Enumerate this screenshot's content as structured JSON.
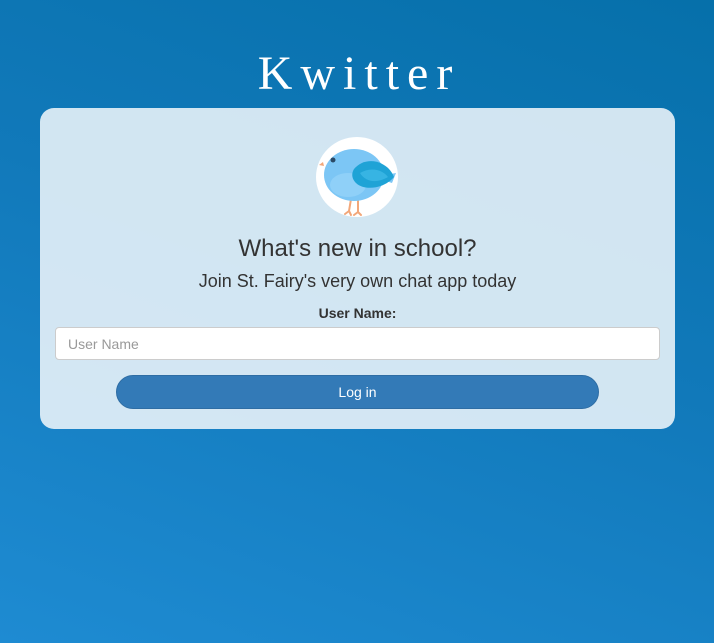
{
  "app": {
    "title": "Kwitter"
  },
  "login_card": {
    "logo_icon": "bird-icon",
    "headline": "What's new in school?",
    "subline": "Join St. Fairy's very own chat app today",
    "username_label": "User Name:",
    "username_value": "",
    "username_placeholder": "User Name",
    "login_button_label": "Log in"
  },
  "colors": {
    "background_top": "#0670aa",
    "background_bottom": "#1e8bd2",
    "card_background": "#e8f2f8",
    "button_primary": "#337ab7",
    "bird_body": "#7cc6f5",
    "bird_wing": "#1fa3d6"
  }
}
